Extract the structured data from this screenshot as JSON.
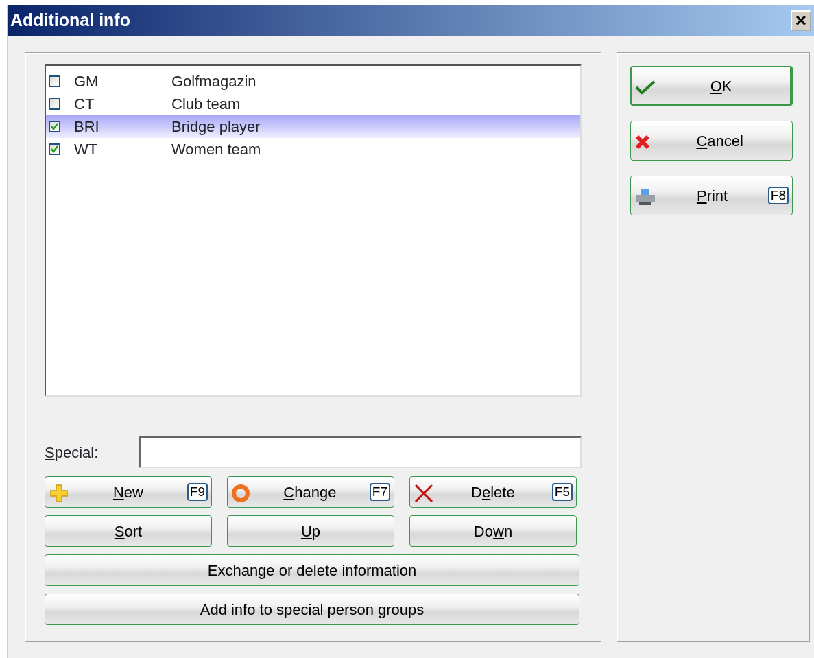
{
  "window": {
    "title": "Additional info",
    "close": "×"
  },
  "list": {
    "rows": [
      {
        "code": "GM",
        "name": "Golfmagazin",
        "checked": false,
        "selected": false
      },
      {
        "code": "CT",
        "name": "Club team",
        "checked": false,
        "selected": false
      },
      {
        "code": "BRI",
        "name": "Bridge player",
        "checked": true,
        "selected": true
      },
      {
        "code": "WT",
        "name": "Women team",
        "checked": true,
        "selected": false
      }
    ]
  },
  "special": {
    "label": {
      "key": "S",
      "post": "pecial:"
    }
  },
  "buttons": [
    {
      "kind": "new",
      "label": {
        "key": "N",
        "post": "ew"
      },
      "shortcut": "F9"
    },
    {
      "kind": "change",
      "label": {
        "key": "C",
        "post": "hange"
      },
      "shortcut": "F7"
    },
    {
      "kind": "delete",
      "label": {
        "pre": "D",
        "key": "e",
        "post": "lete"
      },
      "shortcut": "F5"
    },
    {
      "kind": "plain",
      "label": {
        "key": "S",
        "post": "ort"
      }
    },
    {
      "kind": "plain",
      "label": {
        "key": "U",
        "post": "p"
      }
    },
    {
      "kind": "plain",
      "label": {
        "pre": "Do",
        "key": "w",
        "post": "n"
      }
    },
    {
      "kind": "wide",
      "label": {
        "pre": "Exchange or delete information"
      }
    },
    {
      "kind": "wide",
      "label": {
        "pre": "Add info to special person groups"
      }
    }
  ],
  "side_buttons": [
    {
      "kind": "ok",
      "label": {
        "key": "O",
        "post": "K"
      }
    },
    {
      "kind": "cancel",
      "label": {
        "key": "C",
        "post": "ancel"
      }
    },
    {
      "kind": "print",
      "label": {
        "key": "P",
        "post": "rint"
      },
      "shortcut": "F8"
    }
  ]
}
